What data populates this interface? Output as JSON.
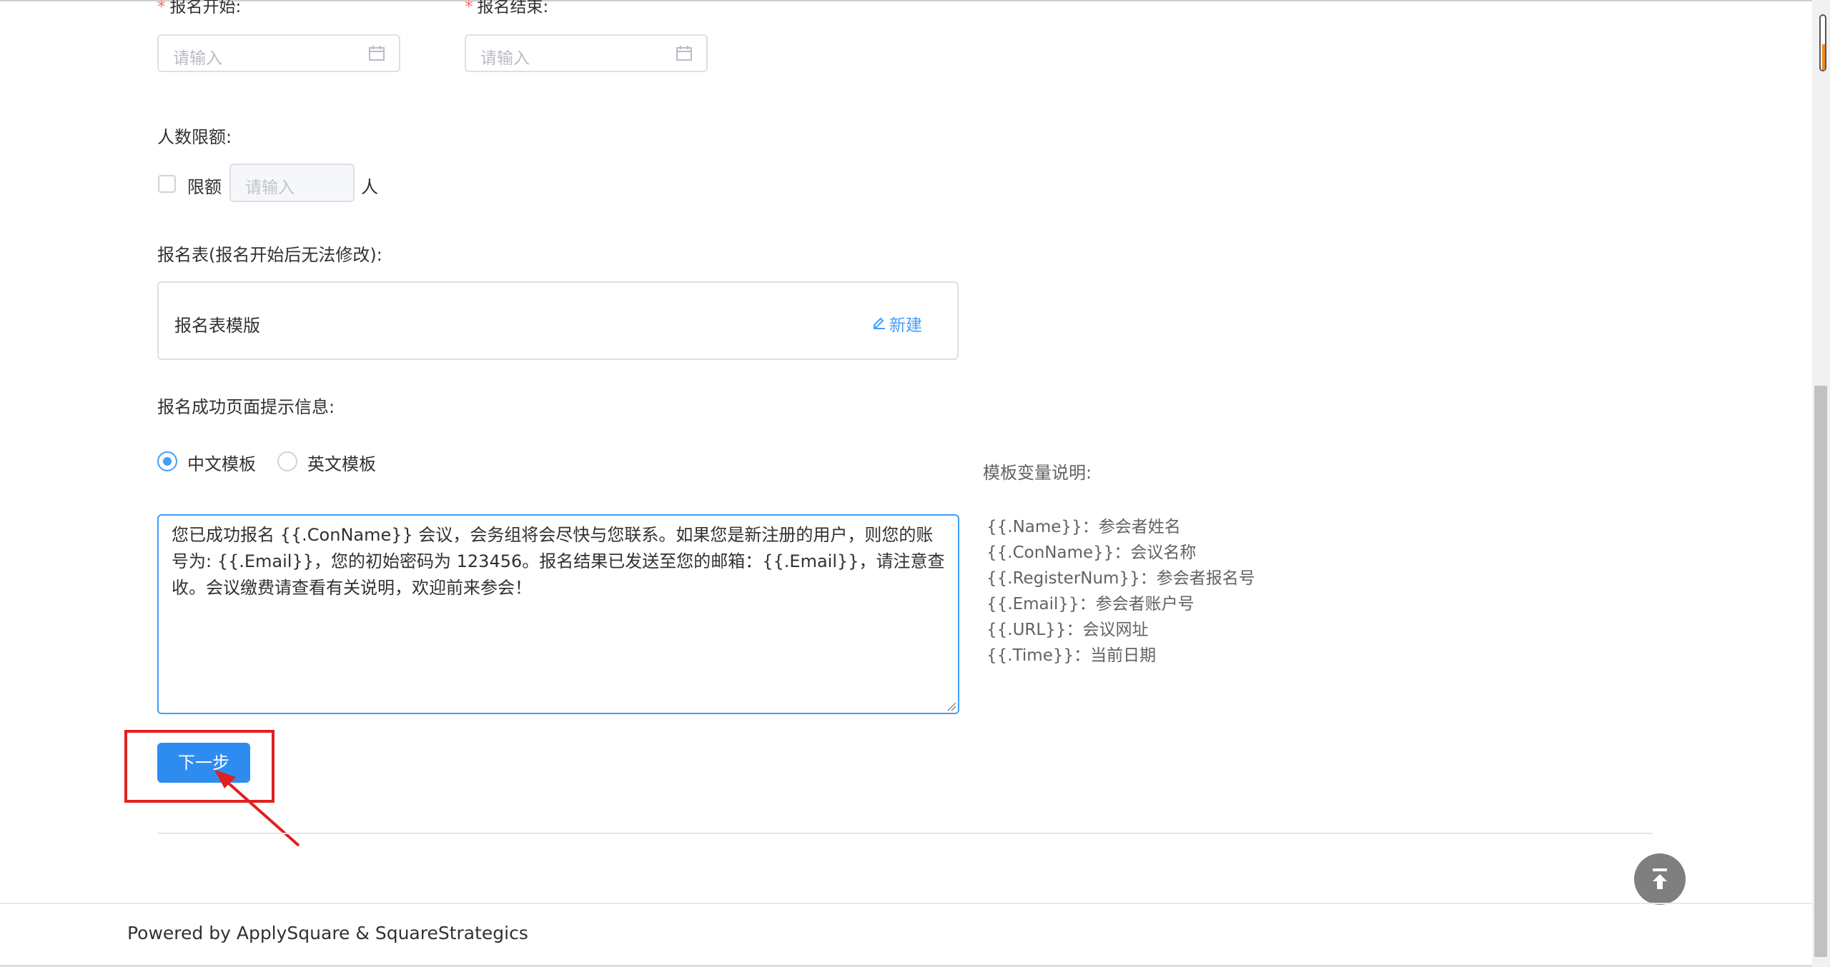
{
  "registration": {
    "start_label": "报名开始:",
    "end_label": "报名结束:",
    "required_mark": "*",
    "start_placeholder": "请输入",
    "end_placeholder": "请输入"
  },
  "quota": {
    "label": "人数限额:",
    "checkbox_label": "限额",
    "placeholder": "请输入",
    "unit": "人"
  },
  "form_section": {
    "label": "报名表(报名开始后无法修改):",
    "template_name": "报名表模版",
    "new_link": "新建"
  },
  "success_message": {
    "label": "报名成功页面提示信息:",
    "radio_options": [
      "中文模板",
      "英文模板"
    ],
    "selected": "中文模板",
    "text": "您已成功报名 {{.ConName}} 会议，会务组将会尽快与您联系。如果您是新注册的用户，则您的账号为: {{.Email}}，您的初始密码为 123456。报名结果已发送至您的邮箱：{{.Email}}，请注意查收。会议缴费请查看有关说明，欢迎前来参会！"
  },
  "variables": {
    "title": "模板变量说明:",
    "items": [
      "{{.Name}}：参会者姓名",
      "{{.ConName}}：会议名称",
      "{{.RegisterNum}}：参会者报名号",
      "{{.Email}}：参会者账户号",
      "{{.URL}}：会议网址",
      "{{.Time}}：当前日期"
    ]
  },
  "actions": {
    "next_label": "下一步"
  },
  "footer": {
    "text": "Powered by ApplySquare & SquareStrategics"
  },
  "colors": {
    "primary": "#409eff",
    "button": "#2e8cf0",
    "annotation_red": "#e02020",
    "required_red": "#f56c6c"
  }
}
